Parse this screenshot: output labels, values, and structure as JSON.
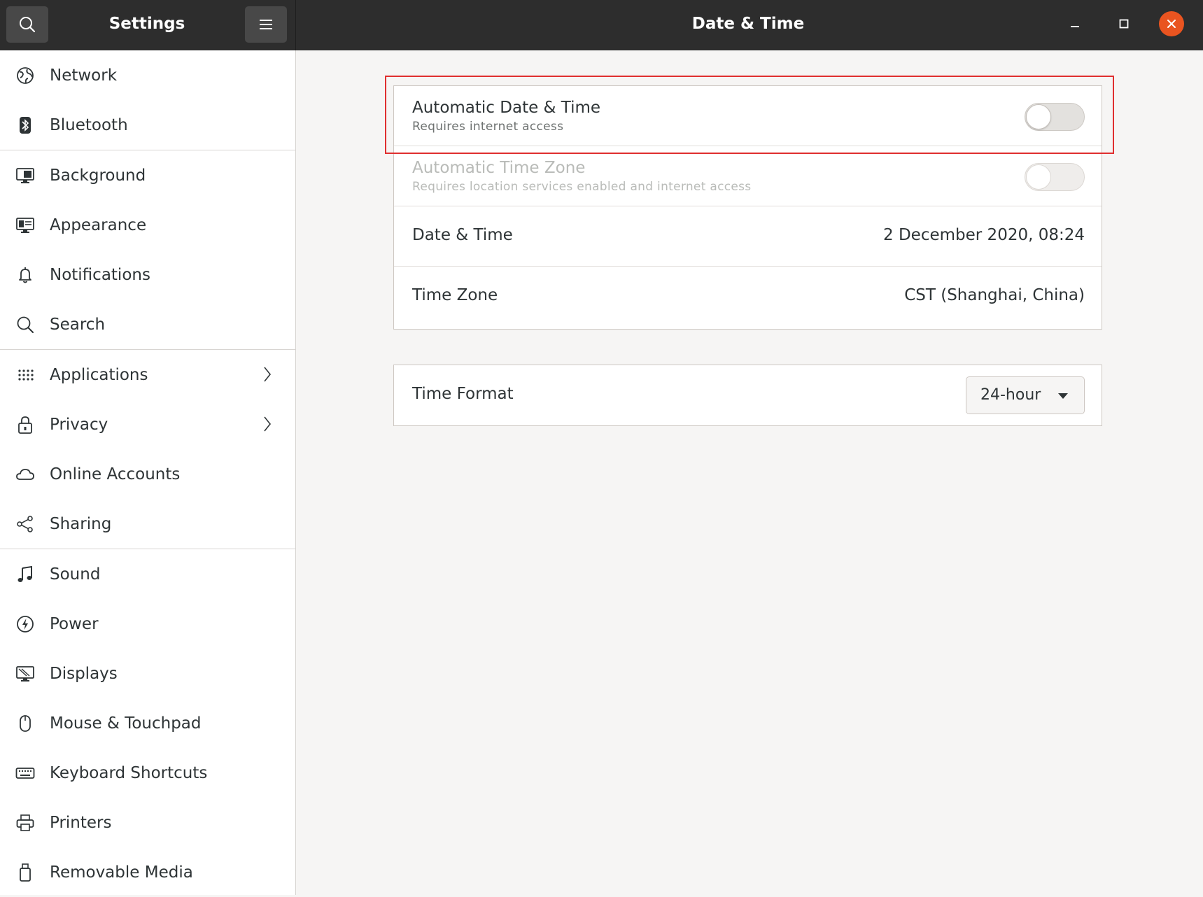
{
  "header": {
    "app_title": "Settings",
    "panel_title": "Date & Time",
    "search_icon": "search-icon",
    "menu_icon": "hamburger-menu-icon",
    "close_color": "#e95420"
  },
  "sidebar": {
    "items": [
      {
        "label": "Network",
        "icon": "network-icon"
      },
      {
        "label": "Bluetooth",
        "icon": "bluetooth-icon"
      },
      {
        "label": "Background",
        "icon": "background-icon"
      },
      {
        "label": "Appearance",
        "icon": "appearance-icon"
      },
      {
        "label": "Notifications",
        "icon": "bell-icon"
      },
      {
        "label": "Search",
        "icon": "search-icon"
      },
      {
        "label": "Applications",
        "icon": "apps-grid-icon"
      },
      {
        "label": "Privacy",
        "icon": "lock-icon"
      },
      {
        "label": "Online Accounts",
        "icon": "cloud-icon"
      },
      {
        "label": "Sharing",
        "icon": "share-icon"
      },
      {
        "label": "Sound",
        "icon": "music-note-icon"
      },
      {
        "label": "Power",
        "icon": "power-icon"
      },
      {
        "label": "Displays",
        "icon": "display-icon"
      },
      {
        "label": "Mouse & Touchpad",
        "icon": "mouse-icon"
      },
      {
        "label": "Keyboard Shortcuts",
        "icon": "keyboard-icon"
      },
      {
        "label": "Printers",
        "icon": "printer-icon"
      },
      {
        "label": "Removable Media",
        "icon": "usb-drive-icon"
      }
    ]
  },
  "main": {
    "auto_datetime": {
      "title": "Automatic Date & Time",
      "subtitle": "Requires internet access",
      "enabled": false
    },
    "auto_timezone": {
      "title": "Automatic Time Zone",
      "subtitle": "Requires location services enabled and internet access",
      "enabled": false
    },
    "datetime": {
      "title": "Date & Time",
      "value": "2 December 2020, 08:24"
    },
    "timezone": {
      "title": "Time Zone",
      "value": "CST (Shanghai, China)"
    },
    "time_format": {
      "title": "Time Format",
      "value": "24-hour"
    }
  },
  "highlight_color": "#e02f2f"
}
